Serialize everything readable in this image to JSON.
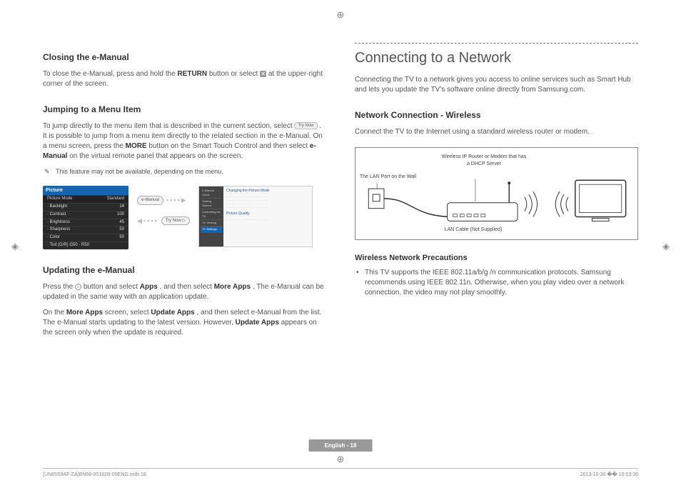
{
  "left": {
    "closing": {
      "title": "Closing the e-Manual",
      "body_a": "To close the e-Manual, press and hold the ",
      "returnBtn": "RETURN",
      "body_b": " button or select ",
      "body_c": " at the upper-right corner of the screen."
    },
    "jumping": {
      "title": "Jumping to a Menu Item",
      "body_a": "To jump directly to the menu item that is described in the current section, select ",
      "tryNow": "Try Now",
      "body_b": ". It is possible to jump from a menu item directly to the related section in the e-Manual. On a menu screen, press the ",
      "more": "MORE",
      "body_c": " button on the Smart Touch Control and then select ",
      "emanual": "e-Manual",
      "body_d": " on the virtual remote panel that appears on the screen.",
      "note": "This feature may not be available, depending on the menu."
    },
    "figure": {
      "menuTitle": "Picture",
      "menuHeadL": "Picture Mode",
      "menuHeadR": "Standard",
      "rows": [
        {
          "l": "· Backlight",
          "r": "14"
        },
        {
          "l": "· Contrast",
          "r": "100"
        },
        {
          "l": "· Brightness",
          "r": "45"
        },
        {
          "l": "· Sharpness",
          "r": "50"
        },
        {
          "l": "· Color",
          "r": "50"
        },
        {
          "l": "· Tint (G/R)   G50     ·     R50",
          "r": ""
        }
      ],
      "pillEmanual": "e-Manual",
      "pillTryNow": "Try Now ▷",
      "sideItems": [
        "e-Manual Guide",
        "Getting Started",
        "Controlling the TV",
        "TV Viewing",
        "TV Settings"
      ],
      "miniTitle": "Changing the Picture Mode",
      "miniSub": "Picture Quality"
    },
    "updating": {
      "title": "Updating the e-Manual",
      "p1a": "Press the ",
      "p1b": " button and select ",
      "apps": "Apps",
      "p1c": ", and then select ",
      "moreApps": "More Apps",
      "p1d": ". The e-Manual can be updated in the same way with an application update.",
      "p2a": "On the ",
      "p2b": " screen, select ",
      "updateApps": "Update Apps",
      "p2c": ", and then select e-Manual from the list. The e-Manual starts updating to the latest version. However, ",
      "p2d": " appears on the screen only when the update is required."
    }
  },
  "right": {
    "h1": "Connecting to a Network",
    "intro": "Connecting the TV to a network gives you access to online services such as Smart Hub and lets you update the TV's software online directly from Samsung.com.",
    "wireless": {
      "title": "Network Connection - Wireless",
      "body": "Connect the TV to the Internet using a standard wireless router or modem.",
      "labelRouter": "Wireless IP Router or Modem that has a DHCP Server",
      "labelWall": "The LAN Port on the Wall",
      "labelCable": "LAN Cable (Not Supplied)"
    },
    "precautions": {
      "title": "Wireless Network Precautions",
      "b1": "This TV supports the IEEE 802.11a/b/g /n communication protocols. Samsung recommends using IEEE 802.11n. Otherwise, when you play video over a network connection, the video may not play smoothly."
    }
  },
  "footer": {
    "page": "English - 18",
    "file": "[UN85S9AF-ZA]BN68-05182B-05ENG.indb   18",
    "stamp": "2013-10-30   �� 10:03:36"
  }
}
